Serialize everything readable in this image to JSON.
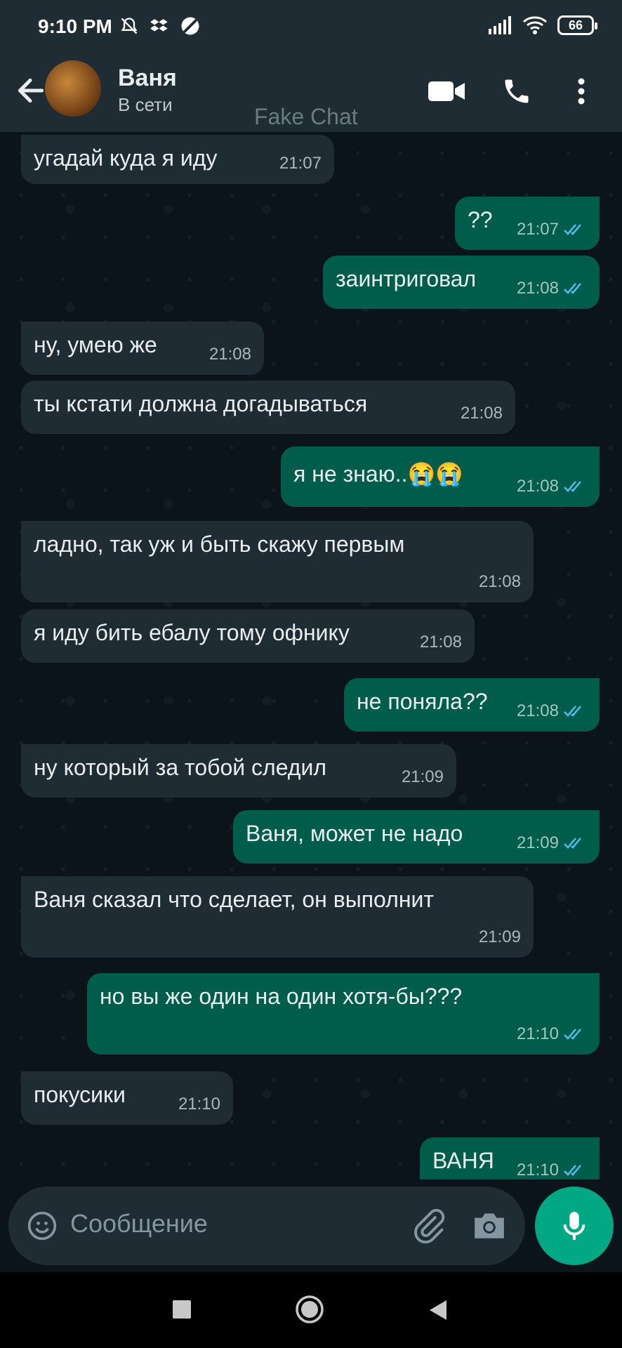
{
  "status_bar": {
    "time": "9:10 PM",
    "battery": "66"
  },
  "header": {
    "contact_name": "Ваня",
    "contact_status": "В сети",
    "watermark": "Fake Chat"
  },
  "messages": [
    {
      "dir": "in",
      "text": "угадай куда я иду",
      "time": "21:07"
    },
    {
      "dir": "out",
      "text": "??",
      "time": "21:07"
    },
    {
      "dir": "out",
      "text": "заинтриговал",
      "time": "21:08"
    },
    {
      "dir": "in",
      "text": "ну, умею же",
      "time": "21:08"
    },
    {
      "dir": "in",
      "text": "ты кстати должна догадываться",
      "time": "21:08"
    },
    {
      "dir": "out",
      "text": "я не знаю..😭😭",
      "time": "21:08"
    },
    {
      "dir": "in",
      "text": "ладно, так уж и быть скажу первым",
      "time": "21:08"
    },
    {
      "dir": "in",
      "text": "я иду бить ебалу тому офнику",
      "time": "21:08"
    },
    {
      "dir": "out",
      "text": "не поняла??",
      "time": "21:08"
    },
    {
      "dir": "in",
      "text": "ну который за тобой следил",
      "time": "21:09"
    },
    {
      "dir": "out",
      "text": "Ваня, может не надо",
      "time": "21:09"
    },
    {
      "dir": "in",
      "text": "Ваня сказал что сделает, он выполнит",
      "time": "21:09"
    },
    {
      "dir": "out",
      "text": "но вы же один на один хотя-бы???",
      "time": "21:10"
    },
    {
      "dir": "in",
      "text": "покусики",
      "time": "21:10"
    },
    {
      "dir": "out",
      "text": "ВАНЯ",
      "time": "21:10"
    }
  ],
  "input": {
    "placeholder": "Сообщение"
  },
  "colors": {
    "incoming_bubble": "#1f2c34",
    "outgoing_bubble": "#005c4b",
    "accent": "#00a884",
    "read_ticks": "#53bdeb"
  },
  "icons": [
    "back-arrow-icon",
    "video-call-icon",
    "phone-icon",
    "more-options-icon",
    "emoji-icon",
    "attach-icon",
    "camera-icon",
    "mic-icon"
  ]
}
